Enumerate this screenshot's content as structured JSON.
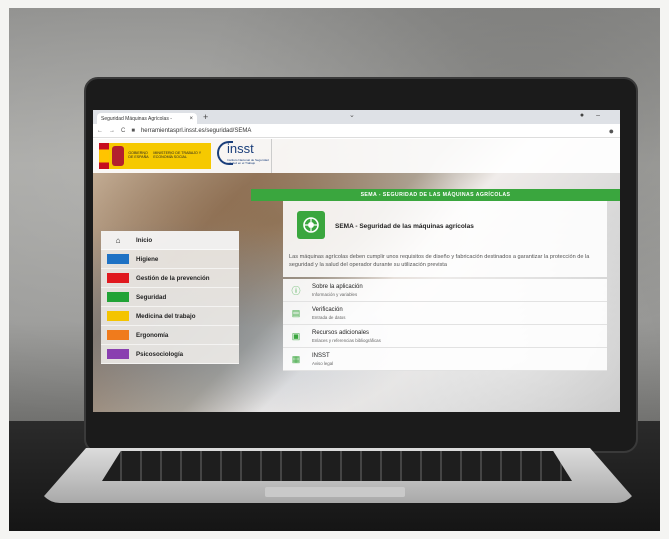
{
  "browser": {
    "tab_title": "Seguridad Máquinas Agrícolas -",
    "tab_close": "×",
    "new_tab": "+",
    "url": "herramientasprl.insst.es/seguridad/SEMA",
    "nav_back": "←",
    "nav_forward": "→",
    "reload": "C",
    "lock": "🔒"
  },
  "header": {
    "gov_text": "GOBIERNO DE ESPAÑA",
    "ministry_text": "MINISTERIO DE TRABAJO Y ECONOMÍA SOCIAL",
    "insst_logo": "insst",
    "insst_sub": "Instituto Nacional de Seguridad y Salud en el Trabajo"
  },
  "banner": {
    "title": "SEMA - SEGURIDAD DE LAS MÁQUINAS AGRÍCOLAS"
  },
  "sidebar": {
    "items": [
      {
        "label": "Inicio",
        "color": "",
        "icon": "home-icon"
      },
      {
        "label": "Higiene",
        "color": "#1f72c4"
      },
      {
        "label": "Gestión de la prevención",
        "color": "#e0191e"
      },
      {
        "label": "Seguridad",
        "color": "#21a336"
      },
      {
        "label": "Medicina del trabajo",
        "color": "#f4c400"
      },
      {
        "label": "Ergonomía",
        "color": "#f07b1c"
      },
      {
        "label": "Psicosociología",
        "color": "#8a3fb0"
      }
    ]
  },
  "main": {
    "title": "SEMA - Seguridad de las máquinas agrícolas",
    "description": "Las máquinas agrícolas deben cumplir unos requisitos de diseño y fabricación destinados a garantizar la protección de la seguridad y la salud del operador durante su utilización prevista",
    "links": [
      {
        "title": "Sobre la aplicación",
        "subtitle": "Información y variables",
        "icon": "info-icon"
      },
      {
        "title": "Verificación",
        "subtitle": "Entrada de datos",
        "icon": "calculator-icon"
      },
      {
        "title": "Recursos adicionales",
        "subtitle": "Enlaces y referencias bibliográficas",
        "icon": "inbox-icon"
      },
      {
        "title": "INSST",
        "subtitle": "Aviso legal",
        "icon": "building-icon"
      }
    ]
  },
  "colors": {
    "accent": "#3aa63e"
  }
}
